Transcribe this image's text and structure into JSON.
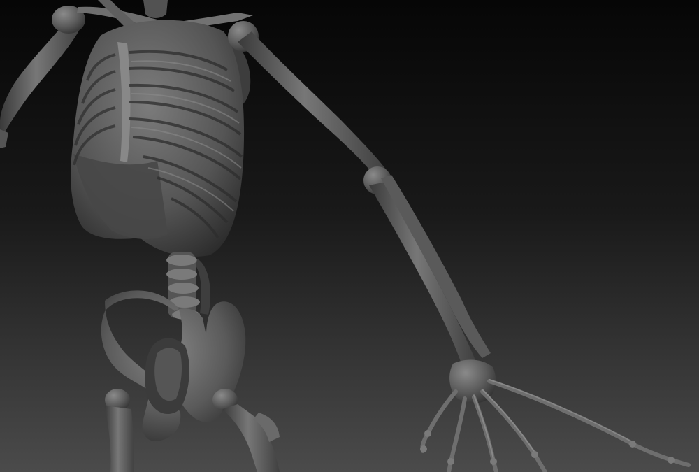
{
  "scene": {
    "subject": "skeleton-sculpt",
    "colors": {
      "background_top": "#050505",
      "background_bottom": "#4a4a4a",
      "bone_light": "#7a7a7a",
      "bone_mid": "#565656",
      "bone_dark": "#2e2e2e"
    }
  }
}
